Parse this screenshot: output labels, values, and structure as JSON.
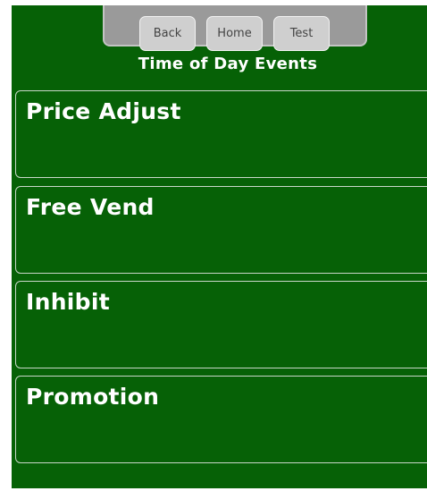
{
  "nav": {
    "back_label": "Back",
    "home_label": "Home",
    "test_label": "Test"
  },
  "page": {
    "title": "Time of Day Events"
  },
  "events": [
    {
      "label": "Price Adjust"
    },
    {
      "label": "Free Vend"
    },
    {
      "label": "Inhibit"
    },
    {
      "label": "Promotion"
    }
  ],
  "colors": {
    "background": "#066106",
    "nav_tray": "#9a9a9a",
    "button": "#cfcfcf",
    "text": "#ffffff",
    "card_border": "#c8d7c8"
  }
}
